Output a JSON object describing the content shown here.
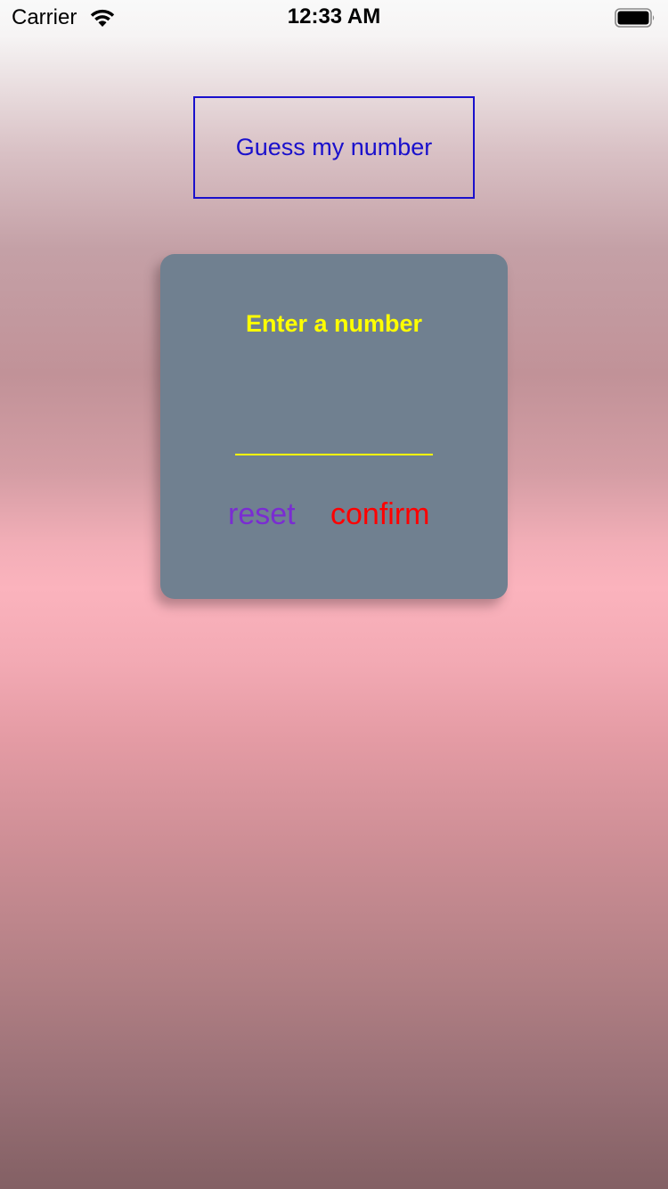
{
  "status_bar": {
    "carrier": "Carrier",
    "time": "12:33 AM",
    "wifi_icon": "wifi-icon",
    "battery_icon": "battery-icon"
  },
  "header": {
    "title": "Guess my number",
    "border_color": "#1a10cc"
  },
  "card": {
    "heading": "Enter a number",
    "input": {
      "value": "",
      "placeholder": ""
    },
    "reset_label": "reset",
    "confirm_label": "confirm",
    "background": "#708090",
    "accent": "#ffff00"
  },
  "colors": {
    "title": "#1a10cc",
    "reset": "#7a2cd2",
    "confirm": "#ff0000",
    "gradient_mid": "#fbb3bd"
  }
}
